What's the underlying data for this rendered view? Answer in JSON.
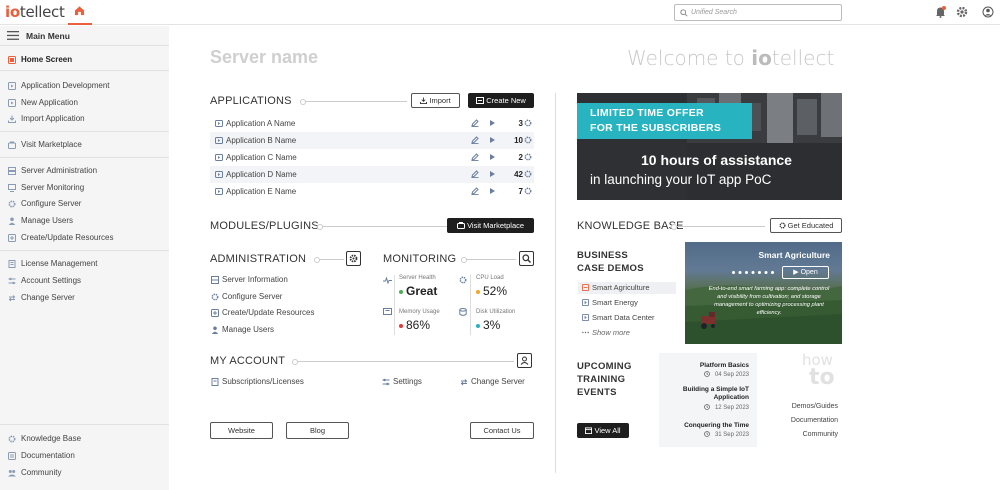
{
  "app": {
    "logo_prefix": "io",
    "logo_suffix": "tellect",
    "search_placeholder": "Unified Search"
  },
  "sidebar": {
    "menu_title": "Main Menu",
    "items": [
      {
        "label": "Home Screen",
        "icon": "home-icon"
      },
      {
        "label": "Application Development",
        "icon": "app-dev-icon"
      },
      {
        "label": "New Application",
        "icon": "new-app-icon"
      },
      {
        "label": "Import Application",
        "icon": "import-icon"
      },
      {
        "label": "Visit Marketplace",
        "icon": "marketplace-icon"
      },
      {
        "label": "Server Administration",
        "icon": "server-admin-icon"
      },
      {
        "label": "Server Monitoring",
        "icon": "monitor-icon"
      },
      {
        "label": "Configure Server",
        "icon": "gear-icon"
      },
      {
        "label": "Manage Users",
        "icon": "users-icon"
      },
      {
        "label": "Create/Update Resources",
        "icon": "resources-icon"
      },
      {
        "label": "License Management",
        "icon": "license-icon"
      },
      {
        "label": "Account Settings",
        "icon": "account-icon"
      },
      {
        "label": "Change Server",
        "icon": "swap-icon"
      },
      {
        "label": "Knowledge Base",
        "icon": "knowledge-icon"
      },
      {
        "label": "Documentation",
        "icon": "doc-icon"
      },
      {
        "label": "Community",
        "icon": "community-icon"
      }
    ]
  },
  "main": {
    "server_name": "Server name",
    "welcome": "Welcome to",
    "welcome_logo_prefix": "io",
    "welcome_logo_suffix": "tellect",
    "applications": {
      "title": "APPLICATIONS",
      "import_label": "Import",
      "create_label": "Create New",
      "rows": [
        {
          "name": "Application A Name",
          "count": "3"
        },
        {
          "name": "Application B Name",
          "count": "10"
        },
        {
          "name": "Application C Name",
          "count": "2"
        },
        {
          "name": "Application D Name",
          "count": "42"
        },
        {
          "name": "Application E Name",
          "count": "7"
        }
      ]
    },
    "modules": {
      "title": "MODULES/PLUGINS",
      "button": "Visit Marketplace"
    },
    "administration": {
      "title": "ADMINISTRATION",
      "items": [
        "Server Information",
        "Configure Server",
        "Create/Update Resources",
        "Manage Users"
      ]
    },
    "monitoring": {
      "title": "MONITORING",
      "metrics": [
        {
          "label": "Server Health",
          "value": "Great",
          "color": "#4caf50"
        },
        {
          "label": "CPU Load",
          "value": "52%",
          "color": "#f5a623"
        },
        {
          "label": "Memory Usage",
          "value": "86%",
          "color": "#e53935"
        },
        {
          "label": "Disk Utilization",
          "value": "3%",
          "color": "#27b3c0"
        }
      ]
    },
    "account": {
      "title": "MY ACCOUNT",
      "items": [
        "Subscriptions/Licenses",
        "Settings",
        "Change Server"
      ]
    },
    "footer_buttons": {
      "website": "Website",
      "blog": "Blog",
      "contact": "Contact Us"
    },
    "promo": {
      "line1": "LIMITED TIME OFFER",
      "line2": "FOR THE SUBSCRIBERS",
      "big1": "10 hours of assistance",
      "big2": "in launching your IoT app PoC"
    },
    "knowledge": {
      "title": "KNOWLEDGE BASE",
      "button": "Get Educated",
      "bcd_line1": "BUSINESS",
      "bcd_line2": "CASE DEMOS",
      "demos": [
        "Smart Agriculture",
        "Smart Energy",
        "Smart Data Center"
      ],
      "show_more": "Show more",
      "card_title": "Smart Agriculture",
      "card_open": "Open",
      "card_desc": "End-to-end smart farming app: complete control and visibility from cultivation; and storage management to optimizing processing plant efficiency."
    },
    "training": {
      "line1": "UPCOMING",
      "line2": "TRAINING",
      "line3": "EVENTS",
      "view_all": "View All",
      "events": [
        {
          "title": "Platform Basics",
          "date": "04 Sep 2023"
        },
        {
          "title": "Building a Simple IoT Application",
          "date": "12 Sep 2023"
        },
        {
          "title": "Conquering the Time",
          "date": "31 Sep 2023"
        }
      ]
    },
    "howto": {
      "word1": "how",
      "word2": "to",
      "links": [
        "Demos/Guides",
        "Documentation",
        "Community"
      ]
    }
  },
  "colors": {
    "accent": "#e8603c",
    "teal": "#27b3c0",
    "dark": "#1e1e1e"
  }
}
